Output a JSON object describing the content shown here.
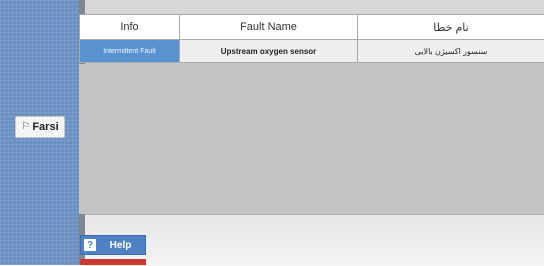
{
  "sidebar": {
    "language_button": {
      "label": "Farsi",
      "icon": "flag-icon"
    }
  },
  "fault_table": {
    "columns": [
      "Info",
      "Fault Name",
      "نام خطا"
    ],
    "rows": [
      [
        "Intermittent Fault",
        "Upstream oxygen sensor",
        "سنسور اکسیژن بالایی"
      ]
    ]
  },
  "footer": {
    "help_label": "Help",
    "help_icon": "question-icon"
  },
  "colors": {
    "sidebar": "#6a90c2",
    "selected_cell": "#5a93d2",
    "help_button": "#4f82c4",
    "alert_strip": "#c93a32"
  }
}
